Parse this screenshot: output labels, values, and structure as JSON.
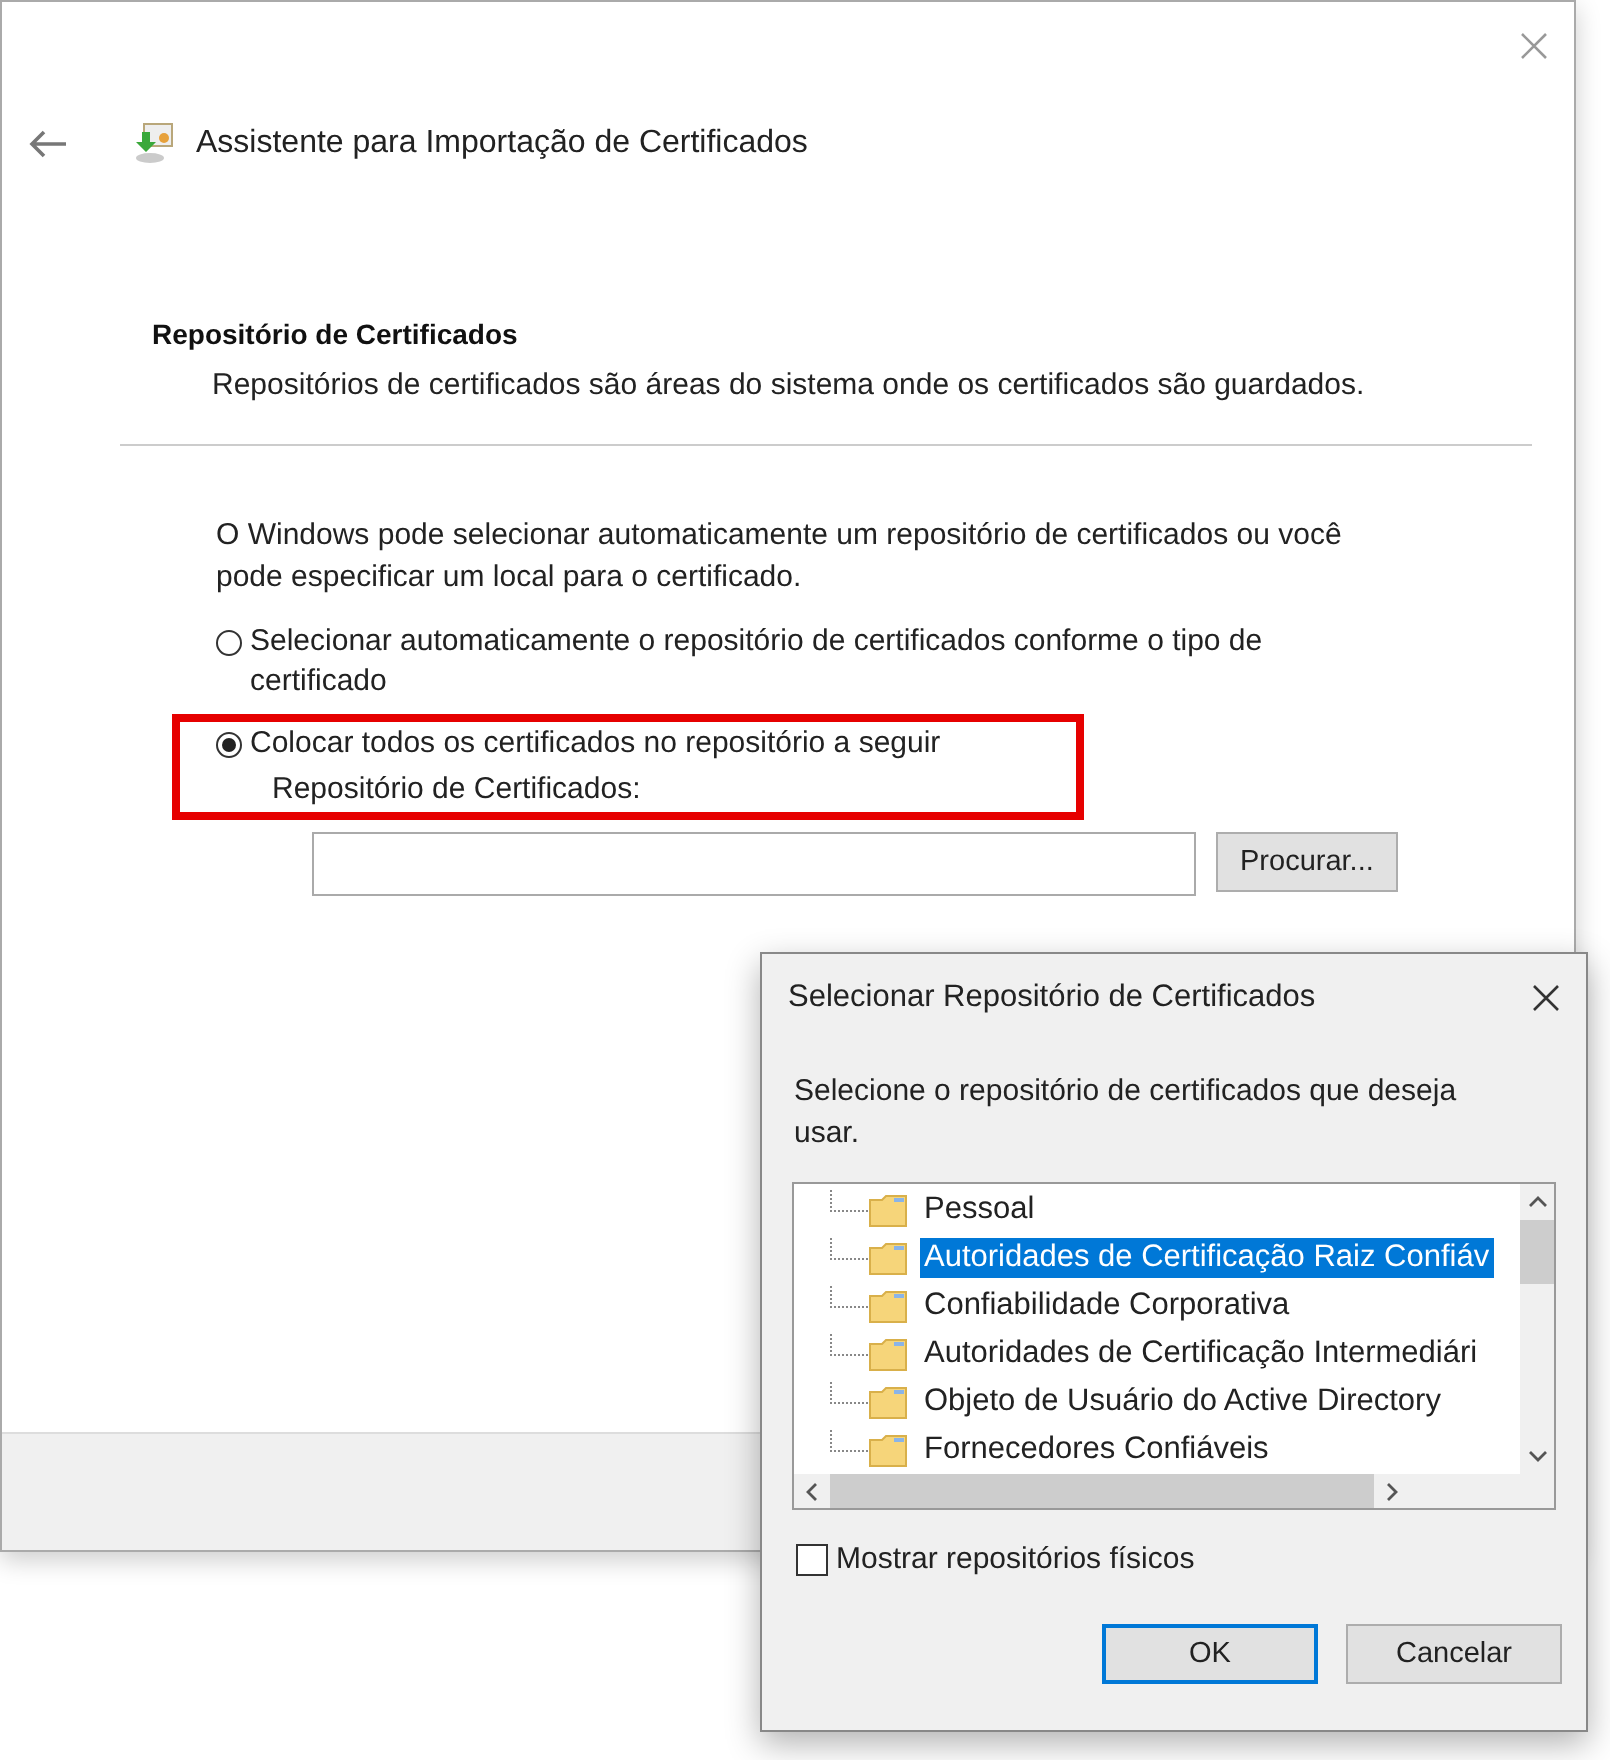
{
  "window": {
    "title": "Assistente para Importação de Certificados"
  },
  "section": {
    "heading": "Repositório de Certificados",
    "description": "Repositórios de certificados são áreas do sistema onde os certificados são guardados."
  },
  "intro": "O Windows pode selecionar automaticamente um repositório de certificados ou você pode especificar um local para o certificado.",
  "options": [
    {
      "label": "Selecionar automaticamente o repositório de certificados conforme o tipo de certificado",
      "selected": false,
      "highlighted": false
    },
    {
      "label": "Colocar todos os certificados no repositório a seguir",
      "selected": true,
      "highlighted": true
    }
  ],
  "store_label": "Repositório de Certificados:",
  "browse_button": "Procurar...",
  "dialog": {
    "title": "Selecionar Repositório de Certificados",
    "prompt": "Selecione o repositório de certificados que deseja usar.",
    "stores": [
      {
        "label": "Pessoal",
        "selected": false
      },
      {
        "label": "Autoridades de Certificação Raiz Confiáv",
        "selected": true
      },
      {
        "label": "Confiabilidade Corporativa",
        "selected": false
      },
      {
        "label": "Autoridades de Certificação Intermediári",
        "selected": false
      },
      {
        "label": "Objeto de Usuário do Active Directory",
        "selected": false
      },
      {
        "label": "Fornecedores Confiáveis",
        "selected": false
      }
    ],
    "show_physical": {
      "label": "Mostrar repositórios físicos",
      "checked": false
    },
    "buttons": [
      {
        "label": "OK",
        "default": true
      },
      {
        "label": "Cancelar",
        "default": false
      }
    ]
  }
}
